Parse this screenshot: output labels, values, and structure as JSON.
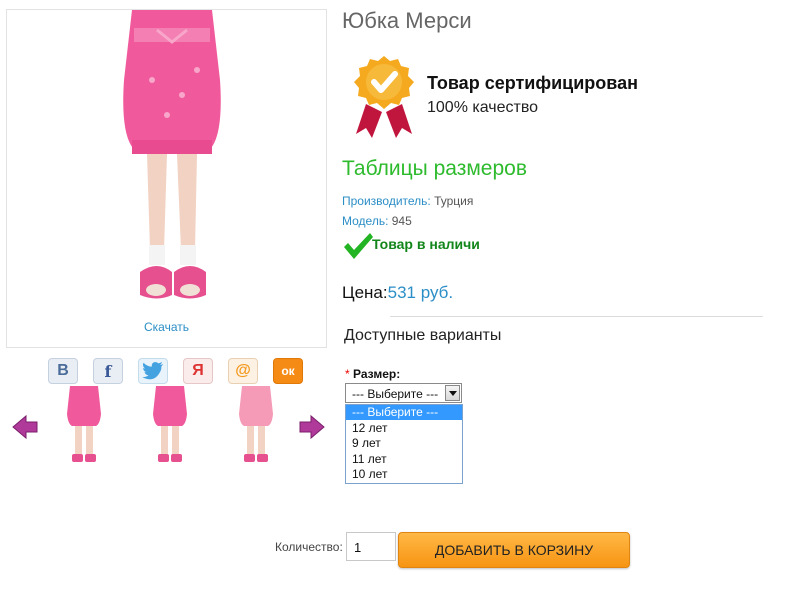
{
  "product": {
    "title": "Юбка Мерси",
    "download_label": "Скачать"
  },
  "certificate": {
    "title": "Товар сертифицирован",
    "subtitle": "100% качество"
  },
  "size_tables_link": "Таблицы размеров",
  "manufacturer": {
    "label": "Производитель:",
    "value": "Турция"
  },
  "model": {
    "label": "Модель:",
    "value": "945"
  },
  "stock_status": "Товар в наличи",
  "price": {
    "label": "Цена:",
    "value": "531 руб."
  },
  "variants": {
    "title": "Доступные варианты",
    "size_required": "*",
    "size_label": "Размер:",
    "selected": "--- Выберите ---",
    "options": [
      "--- Выберите ---",
      "12 лет",
      "9 лет",
      "11 лет",
      "10 лет"
    ]
  },
  "share_icons": [
    "vk-icon",
    "facebook-icon",
    "twitter-icon",
    "moi-mir-icon",
    "mail-ru-icon",
    "odnoklassniki-icon"
  ],
  "share_glyphs": {
    "vk": "В",
    "fb": "f",
    "my": "Я",
    "mail": "@",
    "ok": "ок"
  },
  "quantity": {
    "label": "Количество:",
    "value": "1"
  },
  "cart_button": "ДОБАВИТЬ В КОРЗИНУ",
  "colors": {
    "link": "#2b8ec6",
    "green_title": "#2dbb2d",
    "stock_green": "#12861a",
    "cart_orange": "#f79412",
    "skirt_pink": "#f05a9c",
    "arrow_purple": "#b03a9a"
  }
}
